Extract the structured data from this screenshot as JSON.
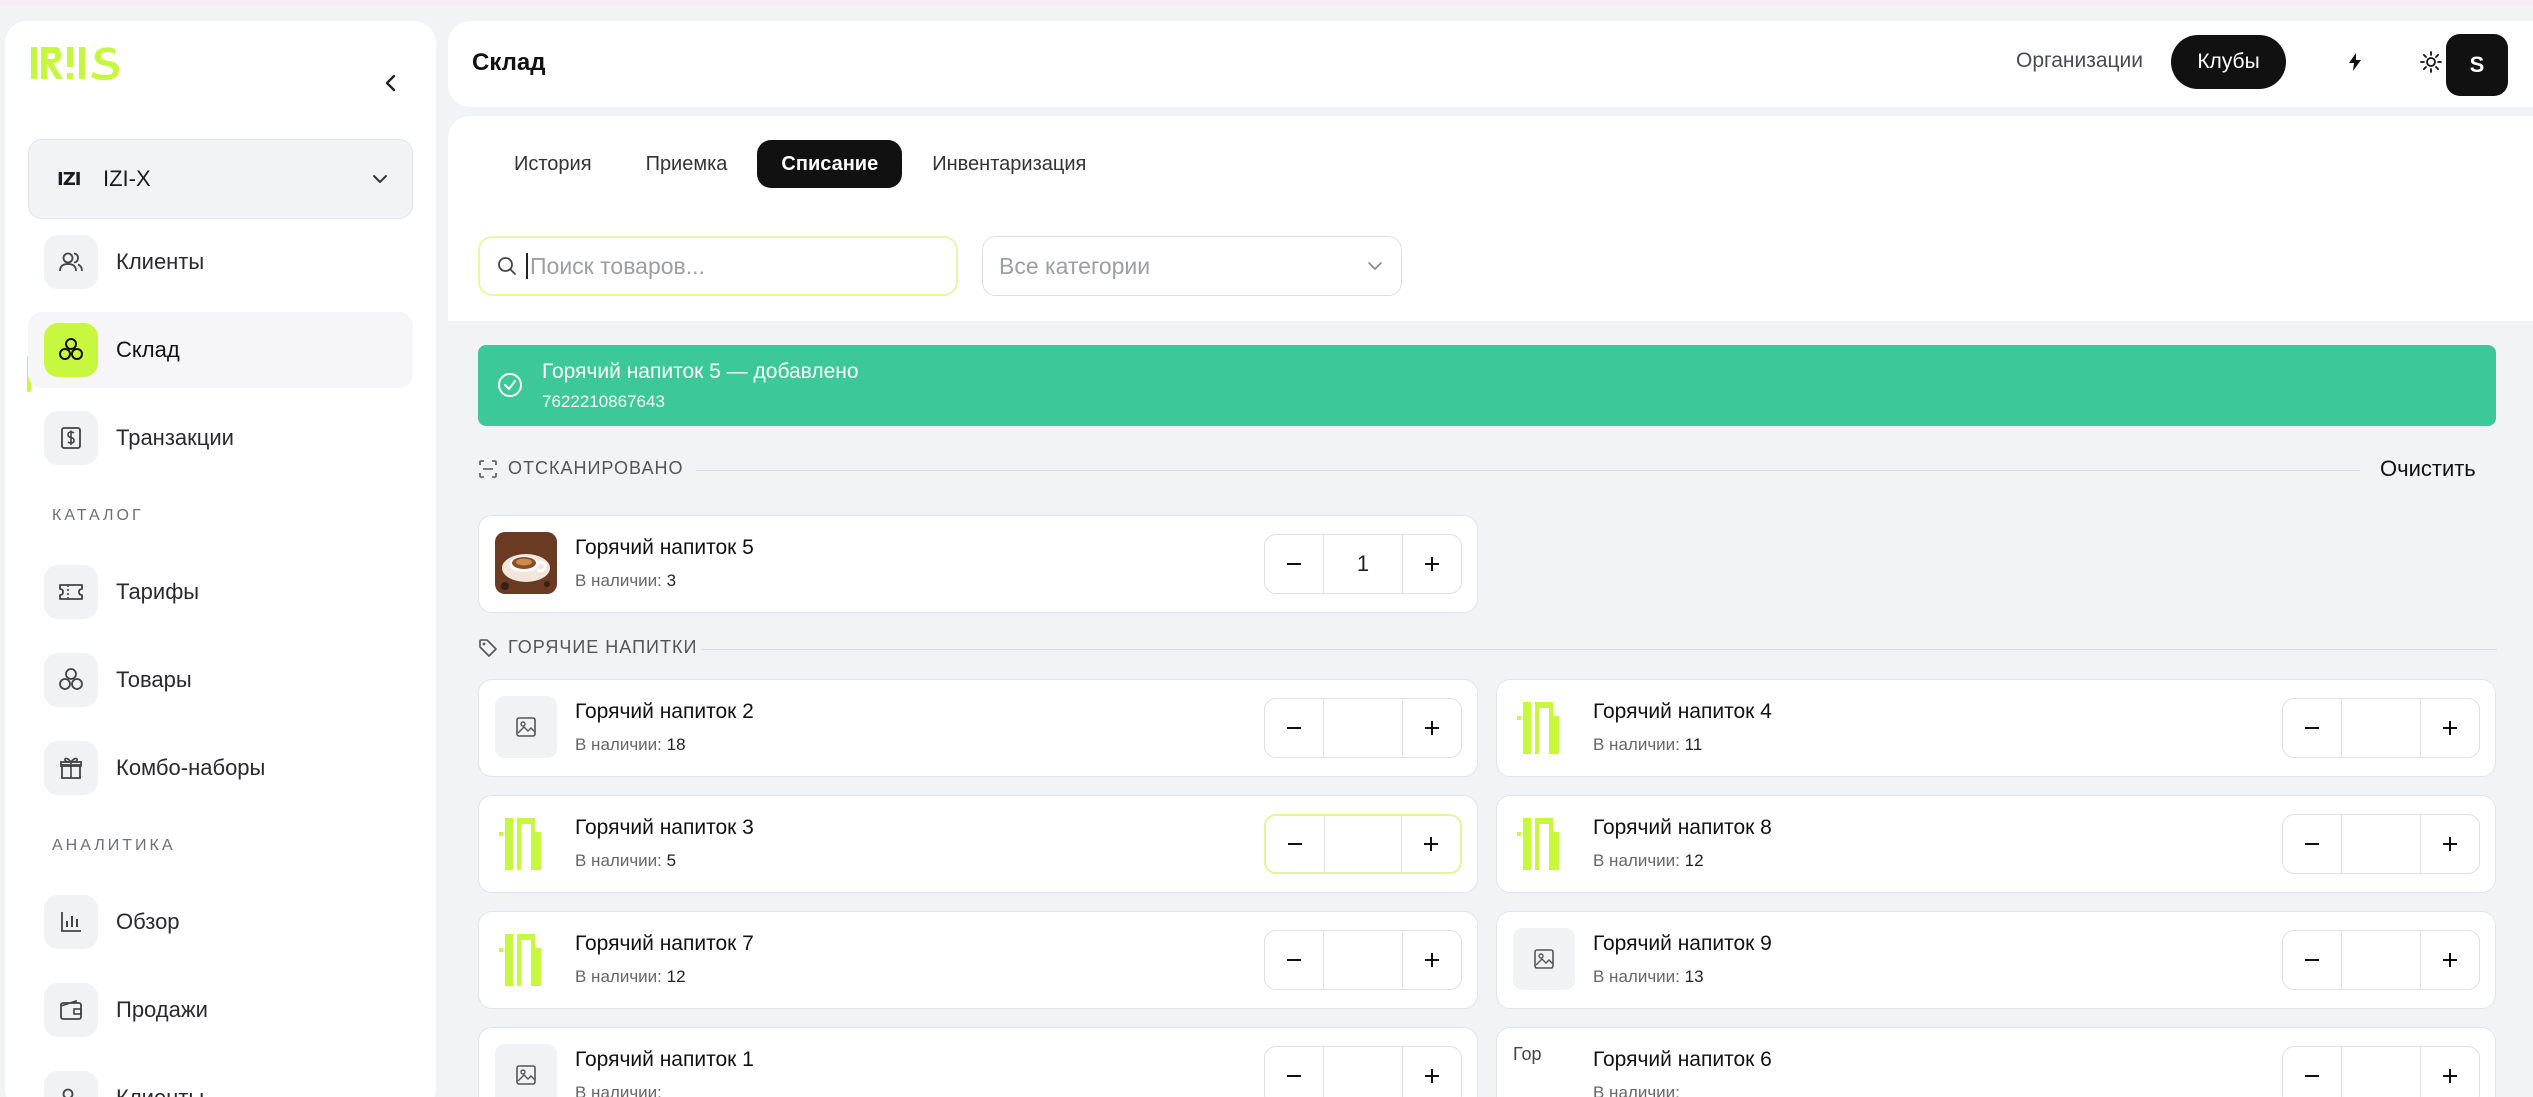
{
  "app": {
    "logo_text": "IZI.IS"
  },
  "sidebar": {
    "org": {
      "mark": "IZI",
      "name": "IZI-X"
    },
    "items": [
      {
        "label": "Клиенты"
      },
      {
        "label": "Склад"
      },
      {
        "label": "Транзакции"
      }
    ],
    "catalog_title": "КАТАЛОГ",
    "catalog_items": [
      {
        "label": "Тарифы"
      },
      {
        "label": "Товары"
      },
      {
        "label": "Комбо-наборы"
      }
    ],
    "analytics_title": "АНАЛИТИКА",
    "analytics_items": [
      {
        "label": "Обзор"
      },
      {
        "label": "Продажи"
      },
      {
        "label": "Клиенты"
      }
    ]
  },
  "header": {
    "title": "Склад",
    "org_link": "Организации",
    "clubs_button": "Клубы",
    "avatar_letter": "S"
  },
  "tabs": [
    {
      "label": "История"
    },
    {
      "label": "Приемка"
    },
    {
      "label": "Списание"
    },
    {
      "label": "Инвентаризация"
    }
  ],
  "search": {
    "placeholder": "Поиск товаров..."
  },
  "category_select": {
    "value": "Все категории"
  },
  "toast": {
    "title": "Горячий напиток 5 — добавлено",
    "barcode": "7622210867643",
    "color": "#3dc899"
  },
  "scanned": {
    "title": "ОТСКАНИРОВАНО",
    "clear_label": "Очистить",
    "items": [
      {
        "name": "Горячий напиток 5",
        "stock_label": "В наличии:",
        "stock": "3",
        "qty": "1"
      }
    ]
  },
  "group": {
    "title": "ГОРЯЧИЕ НАПИТКИ",
    "items": [
      {
        "name": "Горячий напиток 2",
        "stock_label": "В наличии:",
        "stock": "18",
        "qty": ""
      },
      {
        "name": "Горячий напиток 4",
        "stock_label": "В наличии:",
        "stock": "11",
        "qty": ""
      },
      {
        "name": "Горячий напиток 3",
        "stock_label": "В наличии:",
        "stock": "5",
        "qty": ""
      },
      {
        "name": "Горячий напиток 8",
        "stock_label": "В наличии:",
        "stock": "12",
        "qty": ""
      },
      {
        "name": "Горячий напиток 7",
        "stock_label": "В наличии:",
        "stock": "12",
        "qty": ""
      },
      {
        "name": "Горячий напиток 9",
        "stock_label": "В наличии:",
        "stock": "13",
        "qty": ""
      },
      {
        "name": "Горячий напиток 1",
        "stock_label": "В наличии:",
        "stock": "",
        "qty": ""
      },
      {
        "name": "Горячий напиток 6",
        "stock_label": "В наличии:",
        "stock": "",
        "qty": "",
        "alt": "Гор"
      }
    ]
  },
  "colors": {
    "accent": "#c7f73f",
    "dark": "#111111",
    "success": "#3dc899"
  }
}
